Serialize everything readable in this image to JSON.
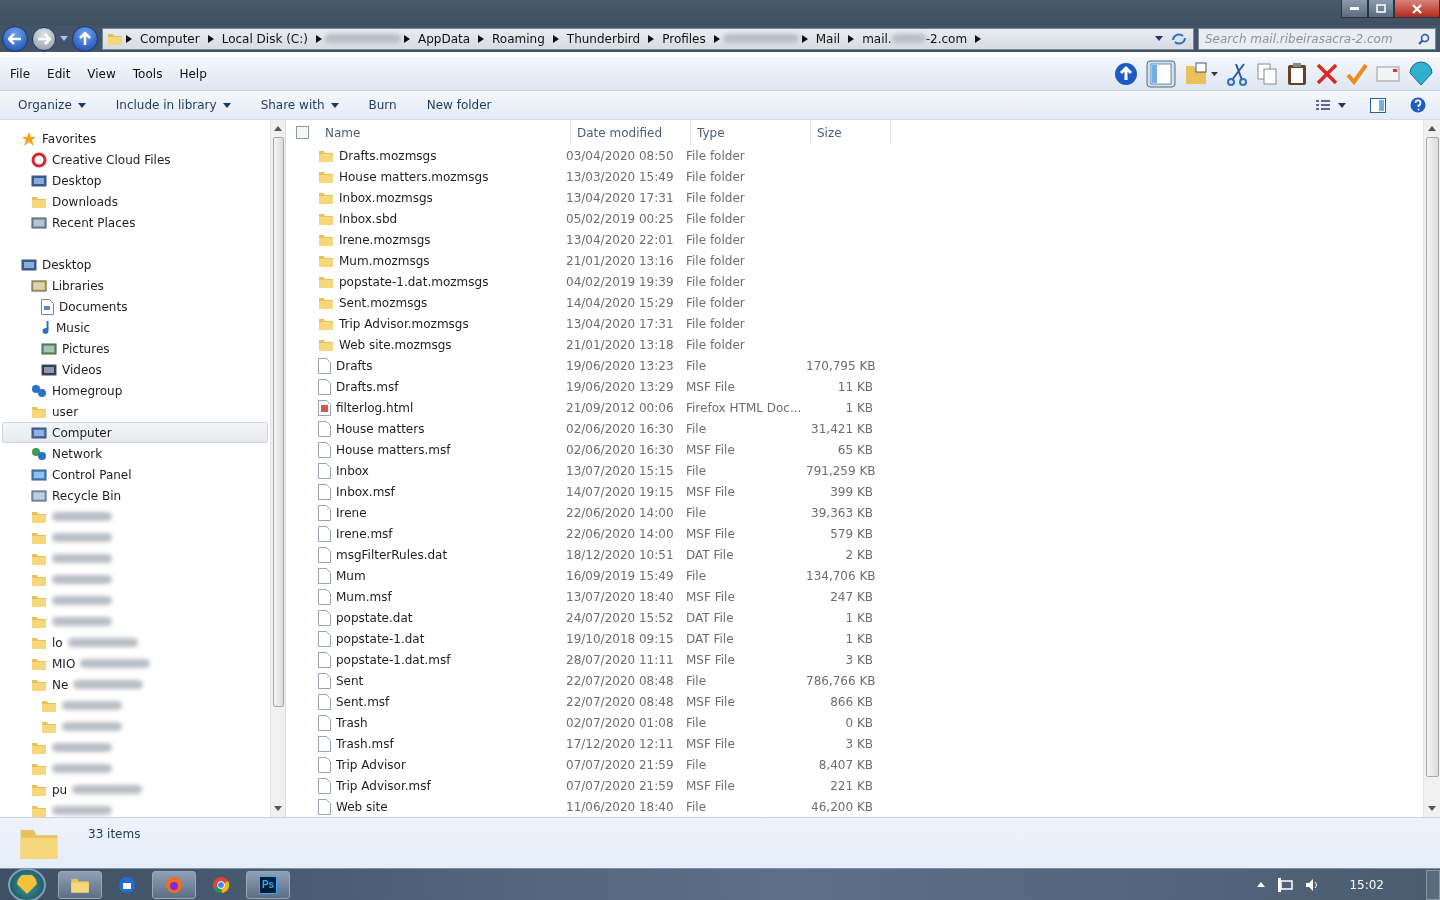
{
  "address_bar": {
    "segments": [
      {
        "label": "Computer",
        "blurred": false
      },
      {
        "label": "Local Disk (C:)",
        "blurred": false
      },
      {
        "blurred": true
      },
      {
        "label": "AppData",
        "blurred": false
      },
      {
        "label": "Roaming",
        "blurred": false
      },
      {
        "label": "Thunderbird",
        "blurred": false
      },
      {
        "label": "Profiles",
        "blurred": false
      },
      {
        "blurred": true
      },
      {
        "label": "Mail",
        "blurred": false
      },
      {
        "label": "mail.",
        "suffix": "-2.com",
        "blurred": true
      }
    ]
  },
  "search": {
    "placeholder": "Search mail.ribeirasacra-2.com"
  },
  "menu": [
    "File",
    "Edit",
    "View",
    "Tools",
    "Help"
  ],
  "commands": [
    {
      "label": "Organize",
      "dropdown": true
    },
    {
      "label": "Include in library",
      "dropdown": true
    },
    {
      "label": "Share with",
      "dropdown": true
    },
    {
      "label": "Burn",
      "dropdown": false
    },
    {
      "label": "New folder",
      "dropdown": false
    }
  ],
  "sidebar": {
    "items": [
      {
        "label": "Favorites",
        "kind": "star",
        "children": [
          {
            "label": "Creative Cloud Files",
            "kind": "cloud"
          },
          {
            "label": "Desktop",
            "kind": "desktop"
          },
          {
            "label": "Downloads",
            "kind": "downloads"
          },
          {
            "label": "Recent Places",
            "kind": "recent"
          }
        ]
      },
      {
        "label": "Desktop",
        "kind": "desktop",
        "children": [
          {
            "label": "Libraries",
            "kind": "libraries",
            "children": [
              {
                "label": "Documents",
                "kind": "document"
              },
              {
                "label": "Music",
                "kind": "music"
              },
              {
                "label": "Pictures",
                "kind": "pictures"
              },
              {
                "label": "Videos",
                "kind": "videos"
              }
            ]
          },
          {
            "label": "Homegroup",
            "kind": "homegroup"
          },
          {
            "label": "user",
            "kind": "user"
          },
          {
            "label": "Computer",
            "kind": "computer",
            "selected": true
          },
          {
            "label": "Network",
            "kind": "network"
          },
          {
            "label": "Control Panel",
            "kind": "control"
          },
          {
            "label": "Recycle Bin",
            "kind": "recycle"
          },
          {
            "kind": "folder",
            "blurred": true
          },
          {
            "kind": "folder",
            "blurred": true
          },
          {
            "kind": "folder",
            "blurred": true
          },
          {
            "kind": "folder",
            "blurred": true
          },
          {
            "kind": "folder",
            "blurred": true
          },
          {
            "kind": "folder",
            "blurred": true
          },
          {
            "label": "lo",
            "kind": "folder",
            "blurred": true
          },
          {
            "label": "MIO",
            "kind": "folder",
            "blurred": true
          },
          {
            "label": "Ne",
            "kind": "folder",
            "blurred": true,
            "children": [
              {
                "kind": "folder",
                "blurred": true
              },
              {
                "kind": "folder",
                "blurred": true
              }
            ]
          },
          {
            "kind": "folder",
            "blurred": true
          },
          {
            "kind": "folder",
            "blurred": true
          },
          {
            "label": "pu",
            "kind": "folder",
            "blurred": true
          },
          {
            "kind": "folder",
            "blurred": true
          }
        ]
      }
    ]
  },
  "table": {
    "select_all": {
      "checked": false
    },
    "columns": [
      "Name",
      "Date modified",
      "Type",
      "Size"
    ],
    "rows": [
      {
        "name": "Drafts.mozmsgs",
        "date": "03/04/2020 08:50",
        "type": "File folder",
        "kind": "folder"
      },
      {
        "name": "House matters.mozmsgs",
        "date": "13/03/2020 15:49",
        "type": "File folder",
        "kind": "folder"
      },
      {
        "name": "Inbox.mozmsgs",
        "date": "13/04/2020 17:31",
        "type": "File folder",
        "kind": "folder"
      },
      {
        "name": "Inbox.sbd",
        "date": "05/02/2019 00:25",
        "type": "File folder",
        "kind": "folder"
      },
      {
        "name": "Irene.mozmsgs",
        "date": "13/04/2020 22:01",
        "type": "File folder",
        "kind": "folder"
      },
      {
        "name": "Mum.mozmsgs",
        "date": "21/01/2020 13:16",
        "type": "File folder",
        "kind": "folder"
      },
      {
        "name": "popstate-1.dat.mozmsgs",
        "date": "04/02/2019 19:39",
        "type": "File folder",
        "kind": "folder"
      },
      {
        "name": "Sent.mozmsgs",
        "date": "14/04/2020 15:29",
        "type": "File folder",
        "kind": "folder"
      },
      {
        "name": "Trip Advisor.mozmsgs",
        "date": "13/04/2020 17:31",
        "type": "File folder",
        "kind": "folder"
      },
      {
        "name": "Web site.mozmsgs",
        "date": "21/01/2020 13:18",
        "type": "File folder",
        "kind": "folder"
      },
      {
        "name": "Drafts",
        "date": "19/06/2020 13:23",
        "type": "File",
        "size": "170,795 KB",
        "kind": "file"
      },
      {
        "name": "Drafts.msf",
        "date": "19/06/2020 13:29",
        "type": "MSF File",
        "size": "11 KB",
        "kind": "file"
      },
      {
        "name": "filterlog.html",
        "date": "21/09/2012 00:06",
        "type": "Firefox HTML Doc...",
        "size": "1 KB",
        "kind": "html"
      },
      {
        "name": "House matters",
        "date": "02/06/2020 16:30",
        "type": "File",
        "size": "31,421 KB",
        "kind": "file"
      },
      {
        "name": "House matters.msf",
        "date": "02/06/2020 16:30",
        "type": "MSF File",
        "size": "65 KB",
        "kind": "file"
      },
      {
        "name": "Inbox",
        "date": "13/07/2020 15:15",
        "type": "File",
        "size": "791,259 KB",
        "kind": "file"
      },
      {
        "name": "Inbox.msf",
        "date": "14/07/2020 19:15",
        "type": "MSF File",
        "size": "399 KB",
        "kind": "file"
      },
      {
        "name": "Irene",
        "date": "22/06/2020 14:00",
        "type": "File",
        "size": "39,363 KB",
        "kind": "file"
      },
      {
        "name": "Irene.msf",
        "date": "22/06/2020 14:00",
        "type": "MSF File",
        "size": "579 KB",
        "kind": "file"
      },
      {
        "name": "msgFilterRules.dat",
        "date": "18/12/2020 10:51",
        "type": "DAT File",
        "size": "2 KB",
        "kind": "file"
      },
      {
        "name": "Mum",
        "date": "16/09/2019 15:49",
        "type": "File",
        "size": "134,706 KB",
        "kind": "file"
      },
      {
        "name": "Mum.msf",
        "date": "13/07/2020 18:40",
        "type": "MSF File",
        "size": "247 KB",
        "kind": "file"
      },
      {
        "name": "popstate.dat",
        "date": "24/07/2020 15:52",
        "type": "DAT File",
        "size": "1 KB",
        "kind": "file"
      },
      {
        "name": "popstate-1.dat",
        "date": "19/10/2018 09:15",
        "type": "DAT File",
        "size": "1 KB",
        "kind": "file"
      },
      {
        "name": "popstate-1.dat.msf",
        "date": "28/07/2020 11:11",
        "type": "MSF File",
        "size": "3 KB",
        "kind": "file"
      },
      {
        "name": "Sent",
        "date": "22/07/2020 08:48",
        "type": "File",
        "size": "786,766 KB",
        "kind": "file"
      },
      {
        "name": "Sent.msf",
        "date": "22/07/2020 08:48",
        "type": "MSF File",
        "size": "866 KB",
        "kind": "file"
      },
      {
        "name": "Trash",
        "date": "02/07/2020 01:08",
        "type": "File",
        "size": "0 KB",
        "kind": "file"
      },
      {
        "name": "Trash.msf",
        "date": "17/12/2020 12:11",
        "type": "MSF File",
        "size": "3 KB",
        "kind": "file"
      },
      {
        "name": "Trip Advisor",
        "date": "07/07/2020 21:59",
        "type": "File",
        "size": "8,407 KB",
        "kind": "file"
      },
      {
        "name": "Trip Advisor.msf",
        "date": "07/07/2020 21:59",
        "type": "MSF File",
        "size": "221 KB",
        "kind": "file"
      },
      {
        "name": "Web site",
        "date": "11/06/2020 18:40",
        "type": "File",
        "size": "46,200 KB",
        "kind": "file"
      }
    ]
  },
  "status_bar": {
    "count": "33 items"
  },
  "taskbar": {
    "apps": [
      {
        "kind": "explorer",
        "active": true
      },
      {
        "kind": "thunderbird",
        "active": false
      },
      {
        "kind": "firefox",
        "active": true
      },
      {
        "kind": "chrome",
        "active": false
      },
      {
        "kind": "photoshop",
        "label": "Ps",
        "active": true
      }
    ],
    "clock": "15:02"
  }
}
